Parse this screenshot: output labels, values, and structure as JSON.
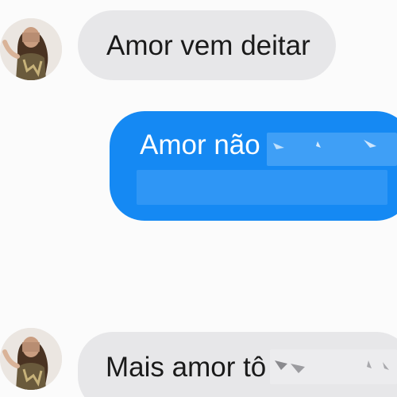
{
  "messages": [
    {
      "direction": "incoming",
      "text": "Amor vem deitar",
      "avatar": "sender-photo"
    },
    {
      "direction": "outgoing",
      "text": "Amor não",
      "redacted": true
    },
    {
      "direction": "incoming",
      "text": "Mais amor tô",
      "redacted": true,
      "avatar": "sender-photo"
    }
  ],
  "colors": {
    "incoming_bubble": "#e7e7e9",
    "outgoing_bubble": "#1589f3",
    "incoming_text": "#1a1a1a",
    "outgoing_text": "#ffffff"
  }
}
